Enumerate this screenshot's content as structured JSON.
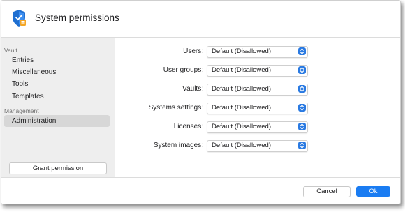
{
  "window": {
    "title": "System permissions",
    "icon": "shield-icon"
  },
  "sidebar": {
    "sections": [
      {
        "label": "Vault",
        "items": [
          "Entries",
          "Miscellaneous",
          "Tools",
          "Templates"
        ]
      },
      {
        "label": "Management",
        "items": [
          "Administration"
        ]
      }
    ],
    "selected": "Administration",
    "grant_button": "Grant permission"
  },
  "permissions": [
    {
      "label": "Users:",
      "value": "Default (Disallowed)"
    },
    {
      "label": "User groups:",
      "value": "Default (Disallowed)"
    },
    {
      "label": "Vaults:",
      "value": "Default (Disallowed)"
    },
    {
      "label": "Systems settings:",
      "value": "Default (Disallowed)"
    },
    {
      "label": "Licenses:",
      "value": "Default (Disallowed)"
    },
    {
      "label": "System images:",
      "value": "Default (Disallowed)"
    }
  ],
  "footer": {
    "cancel_label": "Cancel",
    "ok_label": "Ok"
  },
  "colors": {
    "accent": "#1a7cf2",
    "sidebar_bg": "#eeeeee",
    "selected_bg": "#d7d7d7"
  }
}
